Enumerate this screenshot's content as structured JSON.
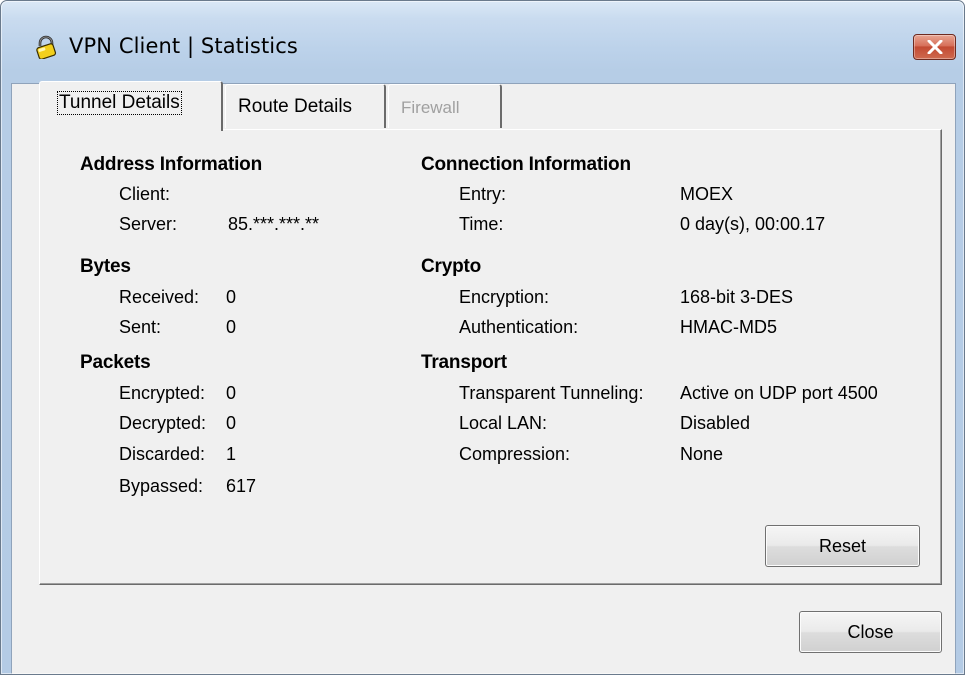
{
  "window": {
    "title": "VPN Client  |  Statistics",
    "icon": "padlock-icon",
    "close_icon": "close-icon"
  },
  "tabs": [
    {
      "label": "Tunnel Details",
      "state": "active"
    },
    {
      "label": "Route Details",
      "state": "normal"
    },
    {
      "label": "Firewall",
      "state": "disabled"
    }
  ],
  "address": {
    "heading": "Address Information",
    "client_label": "Client:",
    "client_value": "",
    "server_label": "Server:",
    "server_value": "85.***.***.**"
  },
  "bytes": {
    "heading": "Bytes",
    "received_label": "Received:",
    "received_value": "0",
    "sent_label": "Sent:",
    "sent_value": "0"
  },
  "packets": {
    "heading": "Packets",
    "encrypted_label": "Encrypted:",
    "encrypted_value": "0",
    "decrypted_label": "Decrypted:",
    "decrypted_value": "0",
    "discarded_label": "Discarded:",
    "discarded_value": "1",
    "bypassed_label": "Bypassed:",
    "bypassed_value": "617"
  },
  "connection": {
    "heading": "Connection Information",
    "entry_label": "Entry:",
    "entry_value": "MOEX",
    "time_label": "Time:",
    "time_value": "0 day(s), 00:00.17"
  },
  "crypto": {
    "heading": "Crypto",
    "encryption_label": "Encryption:",
    "encryption_value": "168-bit 3-DES",
    "authentication_label": "Authentication:",
    "authentication_value": "HMAC-MD5"
  },
  "transport": {
    "heading": "Transport",
    "tunneling_label": "Transparent Tunneling:",
    "tunneling_value": "Active on UDP port 4500",
    "lan_label": "Local LAN:",
    "lan_value": "Disabled",
    "compression_label": "Compression:",
    "compression_value": "None"
  },
  "buttons": {
    "reset": "Reset",
    "close": "Close"
  },
  "colors": {
    "title_bar": "#c4d8ee",
    "close_button": "#c94f36",
    "dialog_face": "#f0f0f0",
    "disabled_text": "#a0a0a0"
  }
}
